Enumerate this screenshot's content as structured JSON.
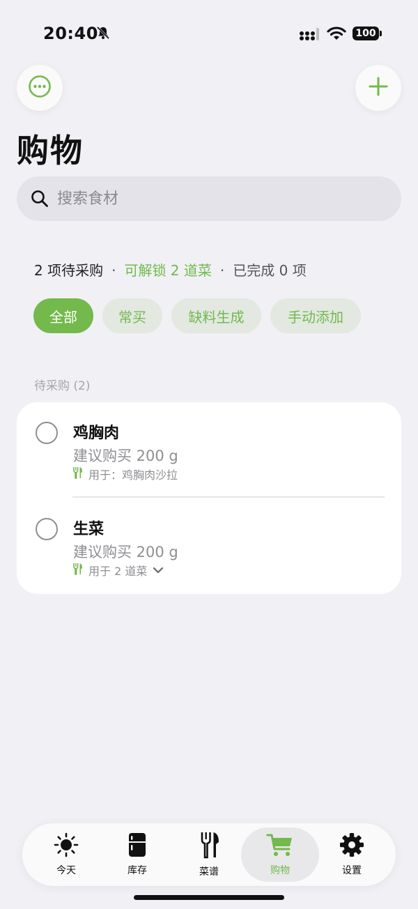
{
  "status_bar": {
    "time": "20:40",
    "battery": "100"
  },
  "header": {
    "title": "购物"
  },
  "search": {
    "placeholder": "搜索食材"
  },
  "summary": {
    "pending": "2 项待采购",
    "unlock": "可解锁 2 道菜",
    "completed": "已完成 0 项",
    "separator": "·"
  },
  "filters": [
    {
      "label": "全部",
      "active": true
    },
    {
      "label": "常买",
      "active": false
    },
    {
      "label": "缺料生成",
      "active": false
    },
    {
      "label": "手动添加",
      "active": false
    }
  ],
  "section": {
    "title": "待采购 (2)"
  },
  "items": [
    {
      "name": "鸡胸肉",
      "quantity": "建议购买 200 g",
      "usage": "用于：鸡胸肉沙拉"
    },
    {
      "name": "生菜",
      "quantity": "建议购买 200 g",
      "usage": "用于 2 道菜"
    }
  ],
  "tabs": [
    {
      "label": "今天",
      "icon": "sun-icon",
      "active": false
    },
    {
      "label": "库存",
      "icon": "fridge-icon",
      "active": false
    },
    {
      "label": "菜谱",
      "icon": "fork-knife-icon",
      "active": false
    },
    {
      "label": "购物",
      "icon": "cart-icon",
      "active": true
    },
    {
      "label": "设置",
      "icon": "gear-icon",
      "active": false
    }
  ],
  "colors": {
    "accent": "#73b94c",
    "background": "#f1f0f5",
    "card": "#ffffff",
    "muted": "#8e8e93"
  }
}
